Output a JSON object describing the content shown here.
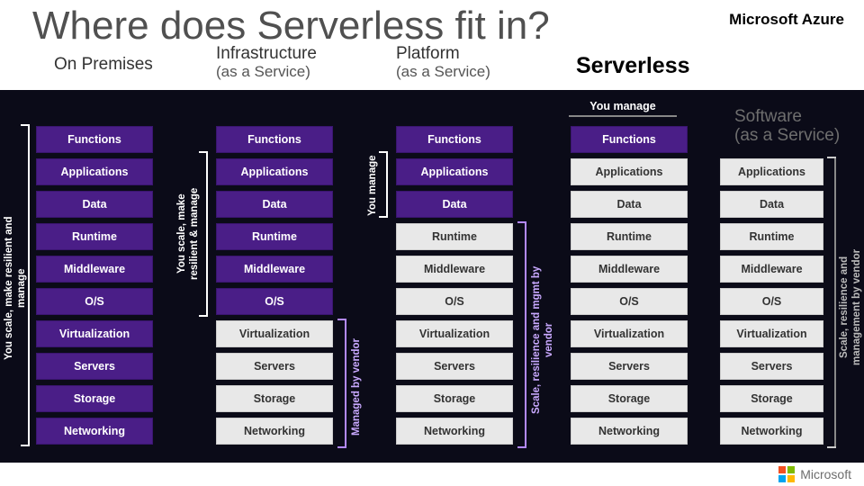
{
  "title": "Where does Serverless fit in?",
  "brand": "Microsoft Azure",
  "footer_brand": "Microsoft",
  "you_manage_label": "You manage",
  "columns": [
    {
      "name": "On Premises",
      "sub": ""
    },
    {
      "name": "Infrastructure",
      "sub": "(as a Service)"
    },
    {
      "name": "Platform",
      "sub": "(as a Service)"
    },
    {
      "name": "Serverless",
      "sub": ""
    },
    {
      "name": "Software",
      "sub": "(as a Service)"
    }
  ],
  "layers": [
    "Functions",
    "Applications",
    "Data",
    "Runtime",
    "Middleware",
    "O/S",
    "Virtualization",
    "Servers",
    "Storage",
    "Networking"
  ],
  "chart_data": {
    "type": "table",
    "rows": [
      "Functions",
      "Applications",
      "Data",
      "Runtime",
      "Middleware",
      "O/S",
      "Virtualization",
      "Servers",
      "Storage",
      "Networking"
    ],
    "columns": [
      "On Premises",
      "Infrastructure (as a Service)",
      "Platform (as a Service)",
      "Serverless",
      "Software (as a Service)"
    ],
    "managed_by_you": [
      [
        true,
        true,
        true,
        true,
        true,
        true,
        true,
        true,
        true,
        true
      ],
      [
        true,
        true,
        true,
        true,
        true,
        true,
        false,
        false,
        false,
        false
      ],
      [
        true,
        true,
        true,
        false,
        false,
        false,
        false,
        false,
        false,
        false
      ],
      [
        true,
        false,
        false,
        false,
        false,
        false,
        false,
        false,
        false,
        false
      ],
      [
        false,
        false,
        false,
        false,
        false,
        false,
        false,
        false,
        false,
        false
      ]
    ],
    "side_labels": {
      "on_prem": "You scale, make resilient and manage",
      "iaas_you": "You scale, make\nresilient & manage",
      "iaas_vendor": "Managed by vendor",
      "paas_you": "You manage",
      "paas_vendor": "Scale, resilience and mgmt by vendor",
      "saas_vendor": "Scale, resilience and\nmanagement by vendor"
    }
  }
}
